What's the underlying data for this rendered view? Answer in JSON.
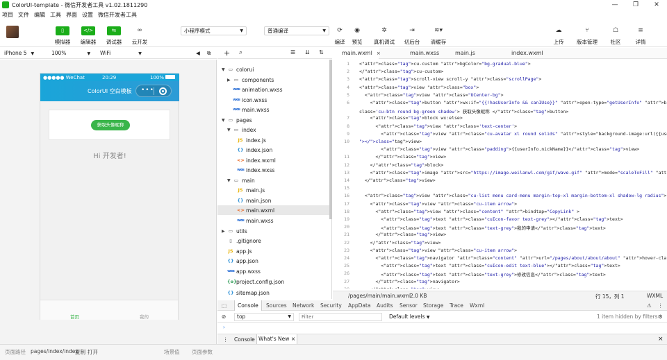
{
  "window": {
    "title": "ColorUI-template - 微信开发者工具 v1.02.1811290",
    "minimize": "—",
    "restore": "❐",
    "close": "✕"
  },
  "menu": [
    "项目",
    "文件",
    "编辑",
    "工具",
    "界面",
    "设置",
    "微信开发者工具"
  ],
  "toolbar": {
    "simulator_label": "模拟器",
    "editor_label": "编辑器",
    "debugger_label": "调试器",
    "cloud_label": "云开发",
    "simulator_icon": "▯",
    "editor_icon": "</>",
    "debugger_icon": "⇆",
    "cloud_icon": "∞",
    "mode_value": "小程序模式",
    "compile_value": "普通编译",
    "compile_label": "编译",
    "preview_label": "预览",
    "realdebug_label": "真机调试",
    "background_label": "切后台",
    "clearcache_label": "清缓存",
    "upload_label": "上传",
    "version_label": "版本管理",
    "community_label": "社区",
    "details_label": "详情",
    "accent_color": "#1aad19"
  },
  "simulator": {
    "device": "iPhone 5",
    "zoom": "100%",
    "network": "WiFi",
    "status_carrier": "●●●●● WeChat",
    "status_time": "20:29",
    "status_battery": "100%",
    "nav_title": "ColorUI 空白模板",
    "capsule_dots": "•••",
    "button_label": "获取头像昵称",
    "greeting": "Hi 开发者!",
    "tab_home": "首页",
    "tab_mine": "我的",
    "nav_color": "#1aa5d9",
    "button_color": "#39b54a"
  },
  "statusbar": {
    "path_label": "页面路径",
    "path_value": "pages/index/index",
    "copy": "复制",
    "open": "打开",
    "scene_label": "场景值",
    "params_label": "页面参数"
  },
  "tree": {
    "colorui": "colorui",
    "components": "components",
    "animation": "animation.wxss",
    "icon": "icon.wxss",
    "main_wxss_root": "main.wxss",
    "pages": "pages",
    "index": "index",
    "index_js": "index.js",
    "index_json": "index.json",
    "index_wxml": "index.wxml",
    "index_wxss": "index.wxss",
    "main": "main",
    "main_js": "main.js",
    "main_json": "main.json",
    "main_wxml": "main.wxml",
    "main_wxss": "main.wxss",
    "utils": "utils",
    "gitignore": ".gitignore",
    "app_js": "app.js",
    "app_json": "app.json",
    "app_wxss": "app.wxss",
    "project_config": "project.config.json",
    "sitemap": "sitemap.json"
  },
  "editor": {
    "tabs": [
      "main.wxml",
      "main.wxss",
      "main.js",
      "index.wxml"
    ],
    "status_path": "/pages/main/main.wxml",
    "status_size": "2.0 KB",
    "status_pos": "行 15，列 1",
    "status_lang": "WXML",
    "lines": [
      {
        "n": "1",
        "code": "<cu-custom bgColor=\"bg-gradual-blue\">"
      },
      {
        "n": "2",
        "code": "</cu-custom>"
      },
      {
        "n": "3",
        "code": "<scroll-view scroll-y class=\"scrollPage\">"
      },
      {
        "n": "4",
        "code": "<view class=\"box\">"
      },
      {
        "n": "5",
        "code": "  <view class=\"UCenter-bg\">"
      },
      {
        "n": "6",
        "code": "    <button wx:if=\"{{!hasUserInfo && canIUse}}\" open-type=\"getUserInfo\" bindgetuserinfo=\"getUserInfo\""
      },
      {
        "n": "",
        "code": "class='cu-btn round bg-green shadow'> 获取头像昵称 </button>"
      },
      {
        "n": "7",
        "code": "    <block wx:else>"
      },
      {
        "n": "8",
        "code": "      <view class='text-center'>"
      },
      {
        "n": "9",
        "code": "        <view class=\"cu-avatar xl round solids\" style=\"background-image:url({{userInfo.avatarUrl}})"
      },
      {
        "n": "10",
        "code": "\"></view>"
      },
      {
        "n": "",
        "code": "        <view class=\"padding\">{{userInfo.nickName}}</view>"
      },
      {
        "n": "11",
        "code": "      </view>"
      },
      {
        "n": "12",
        "code": "    </block>"
      },
      {
        "n": "13",
        "code": "    <image src=\"https://image.weilanwl.com/gif/wave.gif\" mode=\"scaleToFill\" class=\"gif-wave\"></image>"
      },
      {
        "n": "14",
        "code": "  </view>"
      },
      {
        "n": "15",
        "code": ""
      },
      {
        "n": "16",
        "code": "  <view class=\"cu-list menu card-menu margin-top-xl margin-bottom-xl shadow-lg radius\">"
      },
      {
        "n": "17",
        "code": "    <view class=\"cu-item arrow\">"
      },
      {
        "n": "18",
        "code": "      <view class=\"content\" bindtap=\"CopyLink\" >"
      },
      {
        "n": "19",
        "code": "        <text class=\"cuIcon-favor text-grey\"></text>"
      },
      {
        "n": "20",
        "code": "        <text class=\"text-grey\">我的申请</text>"
      },
      {
        "n": "21",
        "code": "      </view>"
      },
      {
        "n": "22",
        "code": "    </view>"
      },
      {
        "n": "23",
        "code": "    <view class=\"cu-item arrow\">"
      },
      {
        "n": "24",
        "code": "      <navigator class=\"content\" url=\"/pages/about/about/about\" hover-class=\"none\">"
      },
      {
        "n": "25",
        "code": "        <text class=\"cuIcon-edit text-blue\"></text>"
      },
      {
        "n": "26",
        "code": "        <text class=\"text-grey\">修改信息</text>"
      },
      {
        "n": "27",
        "code": "      </navigator>"
      },
      {
        "n": "28",
        "code": "    </view>"
      }
    ]
  },
  "devtools": {
    "tabs": [
      "Console",
      "Sources",
      "Network",
      "Security",
      "AppData",
      "Audits",
      "Sensor",
      "Storage",
      "Trace",
      "Wxml"
    ],
    "context": "top",
    "filter_placeholder": "Filter",
    "levels": "Default levels",
    "hidden": "1 item hidden by filters",
    "prompt": "›",
    "drawer_tabs": [
      "Console",
      "What's New"
    ],
    "drawer_close": "×"
  }
}
